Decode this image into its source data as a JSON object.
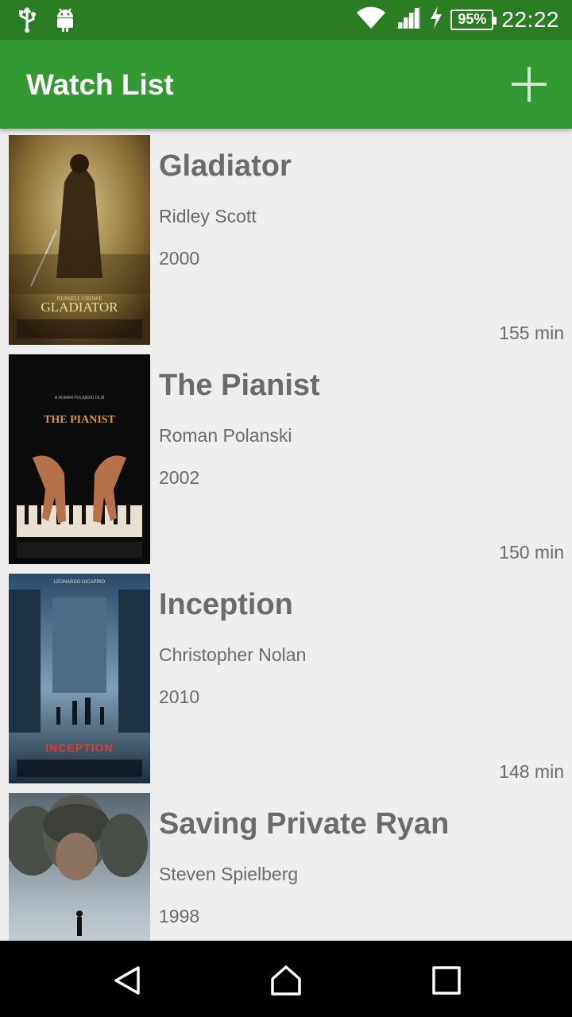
{
  "status_bar": {
    "time": "22:22",
    "battery": "95%",
    "icons": [
      "usb-icon",
      "android-icon",
      "wifi-icon",
      "signal-icon",
      "charging-icon",
      "battery-icon"
    ]
  },
  "app_bar": {
    "title": "Watch List",
    "add_icon": "plus-icon",
    "color": "#339933"
  },
  "movies": [
    {
      "title": "Gladiator",
      "director": "Ridley Scott",
      "year": "2000",
      "duration": "155 min",
      "poster_text": "GLADIATOR",
      "poster_subtext": "RUSSELL CROWE"
    },
    {
      "title": "The Pianist",
      "director": "Roman Polanski",
      "year": "2002",
      "duration": "150 min",
      "poster_text": "THE PIANIST",
      "poster_subtext": "A ROMAN POLANSKI FILM"
    },
    {
      "title": "Inception",
      "director": "Christopher Nolan",
      "year": "2010",
      "duration": "148 min",
      "poster_text": "INCEPTION",
      "poster_subtext": "LEONARDO DICAPRIO"
    },
    {
      "title": "Saving Private Ryan",
      "director": "Steven Spielberg",
      "year": "1998",
      "duration": "",
      "poster_text": "",
      "poster_subtext": ""
    }
  ],
  "nav_bar": {
    "icons": [
      "back-icon",
      "home-icon",
      "recents-icon"
    ]
  }
}
